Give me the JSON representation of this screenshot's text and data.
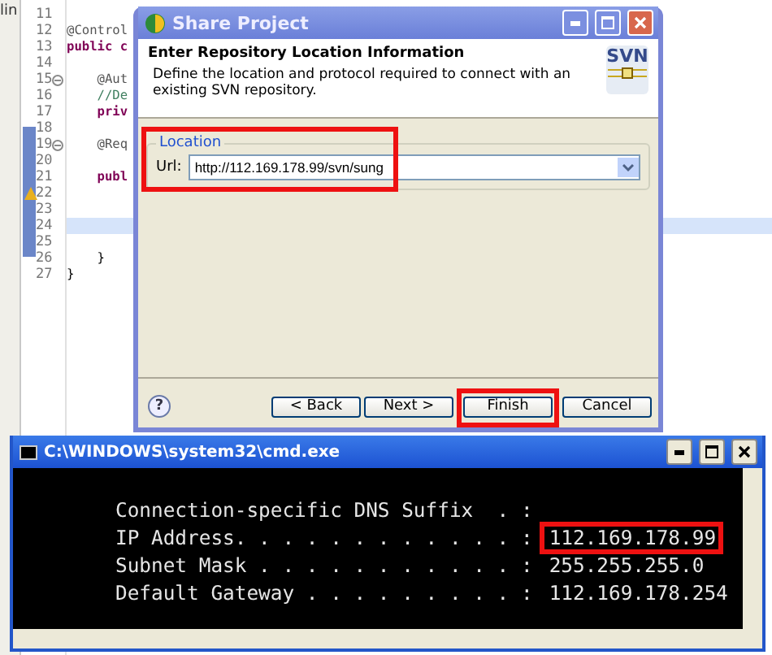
{
  "editor": {
    "side_label": "lin",
    "lines": [
      {
        "number": "11",
        "fold": false,
        "current": false,
        "warning": false
      },
      {
        "number": "12",
        "code": "@Control",
        "kind": "annotation",
        "fold": false,
        "current": false,
        "warning": false
      },
      {
        "number": "13",
        "code": "public c",
        "kind": "keyword",
        "fold": false,
        "current": false,
        "warning": false
      },
      {
        "number": "14",
        "fold": false,
        "current": false,
        "warning": false
      },
      {
        "number": "15",
        "code": "    @Aut",
        "kind": "annotation",
        "fold": true,
        "current": false,
        "warning": false
      },
      {
        "number": "16",
        "code": "    //De",
        "kind": "comment",
        "fold": false,
        "current": false,
        "warning": false
      },
      {
        "number": "17",
        "code": "    priv",
        "kind": "keyword",
        "fold": false,
        "current": false,
        "warning": false
      },
      {
        "number": "18",
        "fold": false,
        "current": false,
        "warning": false
      },
      {
        "number": "19",
        "code": "    @Req",
        "kind": "annotation",
        "fold": true,
        "current": false,
        "warning": false
      },
      {
        "number": "20",
        "fold": false,
        "current": false,
        "warning": false
      },
      {
        "number": "21",
        "code": "    publ",
        "kind": "keyword",
        "fold": false,
        "current": false,
        "warning": false
      },
      {
        "number": "22",
        "fold": false,
        "current": false,
        "warning": true
      },
      {
        "number": "23",
        "fold": false,
        "current": false,
        "warning": false
      },
      {
        "number": "24",
        "fold": false,
        "current": true,
        "warning": false
      },
      {
        "number": "25",
        "fold": false,
        "current": false,
        "warning": false
      },
      {
        "number": "26",
        "code": "    }",
        "kind": "plain",
        "fold": false,
        "current": false,
        "warning": false
      },
      {
        "number": "27",
        "code": "}",
        "kind": "plain",
        "fold": false,
        "current": false,
        "warning": false
      }
    ]
  },
  "dialog": {
    "title": "Share Project",
    "header_title": "Enter Repository Location Information",
    "description": "Define the location and protocol required to connect with an existing SVN repository.",
    "logo": "SVN",
    "group_label": "Location",
    "url_label": "Url:",
    "url_value": "http://112.169.178.99/svn/sung",
    "group_highlighted": true,
    "help_symbol": "?",
    "buttons": [
      {
        "label": "< Back",
        "highlighted": false
      },
      {
        "label": "Next >",
        "highlighted": false
      },
      {
        "label": "Finish",
        "highlighted": true
      },
      {
        "label": "Cancel",
        "highlighted": false
      }
    ]
  },
  "console": {
    "title": "C:\\WINDOWS\\system32\\cmd.exe",
    "lines": [
      {
        "label": "Connection-specific DNS Suffix  . :"
      },
      {
        "label": "IP Address. . . . . . . . . . . . :",
        "value": "112.169.178.99",
        "highlighted": true
      },
      {
        "label": "Subnet Mask . . . . . . . . . . . :",
        "value": "255.255.255.0",
        "highlighted": false
      },
      {
        "label": "Default Gateway . . . . . . . . . :",
        "value": "112.169.178.254",
        "highlighted": false
      }
    ]
  }
}
